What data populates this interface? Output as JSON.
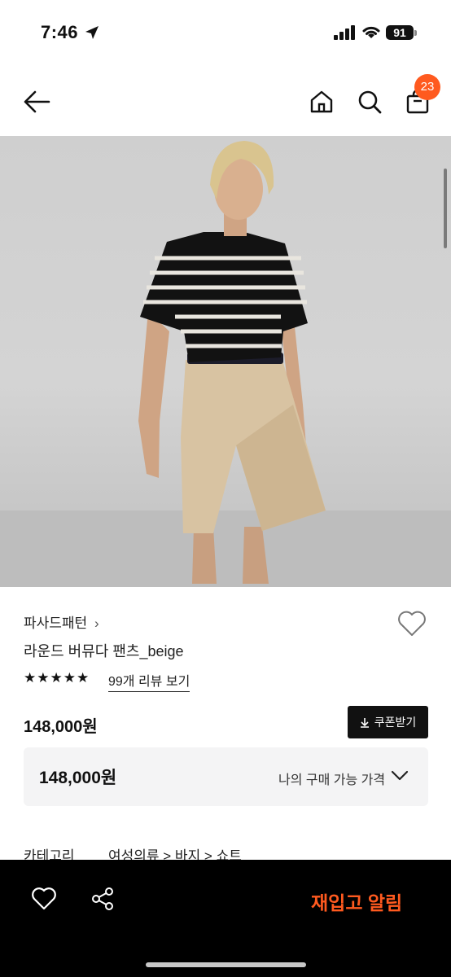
{
  "status": {
    "time": "7:46",
    "battery": "91"
  },
  "nav": {
    "cart_badge": "23"
  },
  "product": {
    "brand": "파사드패턴",
    "brand_chevron": "›",
    "title": "라운드 버뮤다 팬츠_beige",
    "rating_stars": "★★★★★",
    "rating_fraction": 1.0,
    "review_link": "99개 리뷰 보기",
    "price": "148,000원",
    "coupon_label": "쿠폰받기",
    "my_price": "148,000원",
    "my_price_label": "나의 구매 가능 가격",
    "category_label": "카테고리",
    "category_path": "여성의류 > 바지 > 쇼트"
  },
  "bottom_bar": {
    "restock_label": "재입고 알림"
  },
  "colors": {
    "accent": "#ff5a1f",
    "dark": "#000000"
  }
}
